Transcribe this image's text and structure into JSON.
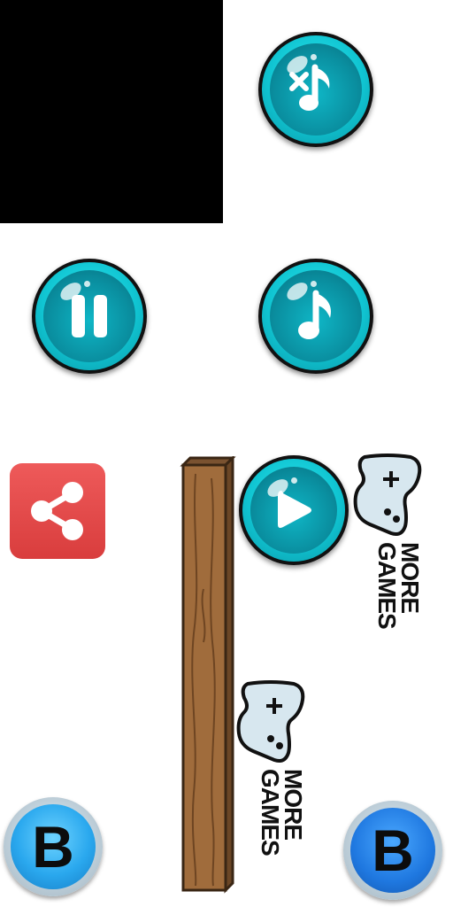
{
  "buttons": {
    "mute_icon": "music-muted-icon",
    "pause_icon": "pause-icon",
    "music_icon": "music-note-icon",
    "play_icon": "play-icon",
    "share_icon": "share-icon"
  },
  "more_games": {
    "label_line1": "MORE",
    "label_line2": "GAMES",
    "icon": "gamepad-icon"
  },
  "b_button": {
    "label": "B"
  },
  "colors": {
    "accent_cyan": "#10c5d2",
    "share_red": "#e14848",
    "plank_brown": "#9b6b3f",
    "b_blue": "#2aa8ee"
  }
}
